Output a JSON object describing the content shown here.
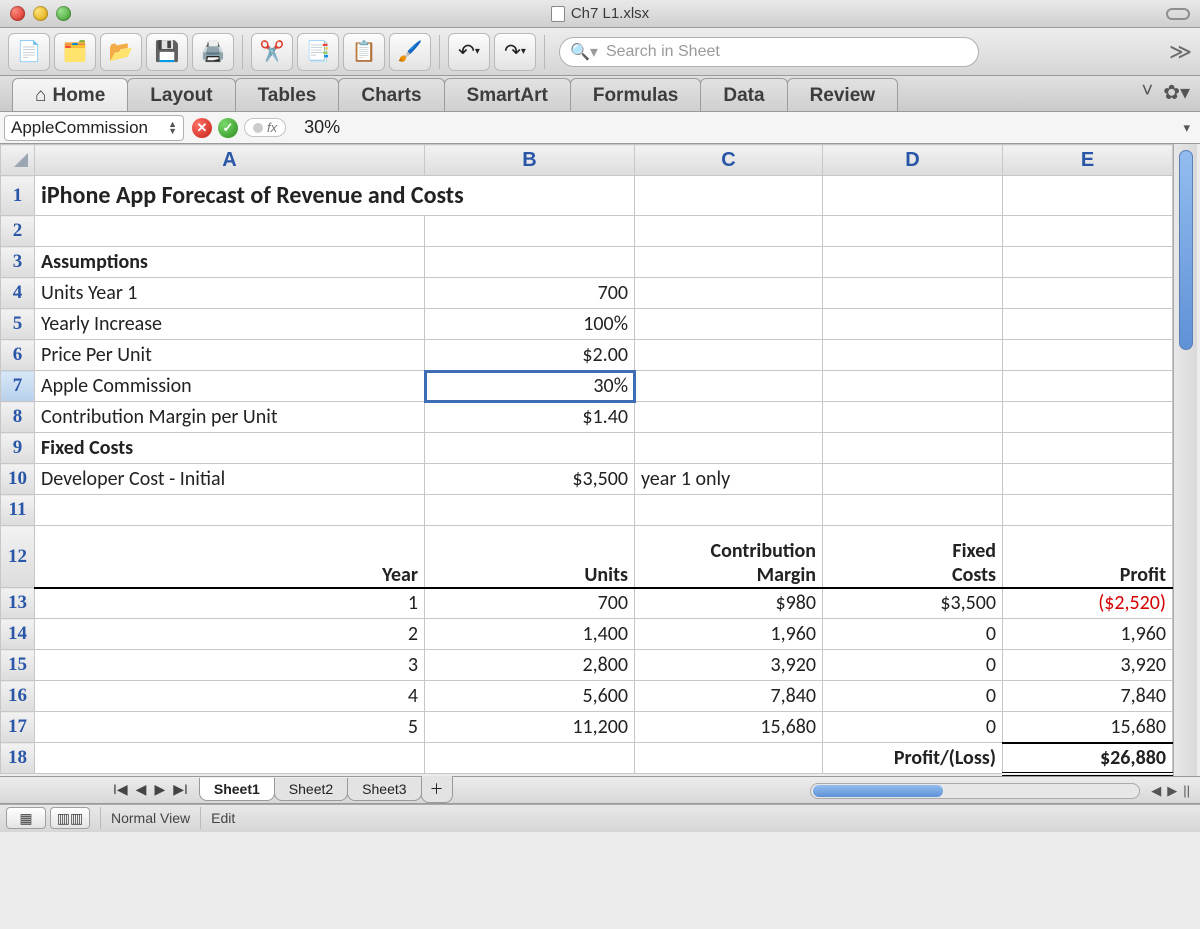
{
  "window": {
    "filename": "Ch7 L1.xlsx"
  },
  "toolbar": {
    "icons": [
      "new-sheet-icon",
      "chart-wizard-icon",
      "open-icon",
      "save-icon",
      "print-icon",
      "cut-icon",
      "copy-icon",
      "paste-icon",
      "format-painter-icon",
      "undo-icon",
      "redo-icon"
    ],
    "search_placeholder": "Search in Sheet"
  },
  "ribbon": {
    "tabs": [
      "Home",
      "Layout",
      "Tables",
      "Charts",
      "SmartArt",
      "Formulas",
      "Data",
      "Review"
    ],
    "active": "Home"
  },
  "formula_bar": {
    "name_box": "AppleCommission",
    "fx_label": "fx",
    "value": "30%"
  },
  "columns": [
    "A",
    "B",
    "C",
    "D",
    "E"
  ],
  "rows_visible": [
    1,
    2,
    3,
    4,
    5,
    6,
    7,
    8,
    9,
    10,
    11,
    12,
    13,
    14,
    15,
    16,
    17,
    18
  ],
  "active_cell": "B7",
  "sheet": {
    "title": "iPhone App Forecast of Revenue and Costs",
    "section_assumptions": "Assumptions",
    "assumptions": {
      "units_year1_label": "Units Year 1",
      "units_year1_value": "700",
      "yearly_increase_label": "Yearly Increase",
      "yearly_increase_value": "100%",
      "price_per_unit_label": "Price Per Unit",
      "price_per_unit_value": "$2.00",
      "apple_commission_label": "Apple Commission",
      "apple_commission_value": "30%",
      "contribution_margin_label": "Contribution Margin per Unit",
      "contribution_margin_value": "$1.40"
    },
    "section_fixed": "Fixed  Costs",
    "fixed": {
      "dev_cost_label": "Developer Cost - Initial",
      "dev_cost_value": "$3,500",
      "dev_cost_note": "year 1 only"
    },
    "table_headers": {
      "year": "Year",
      "units": "Units",
      "contribution_l1": "Contribution",
      "contribution_l2": "Margin",
      "fixed_l1": "Fixed",
      "fixed_l2": "Costs",
      "profit": "Profit"
    },
    "rows": [
      {
        "year": "1",
        "units": "700",
        "margin": "$980",
        "fixed": "$3,500",
        "profit": "($2,520)",
        "neg": true
      },
      {
        "year": "2",
        "units": "1,400",
        "margin": "1,960",
        "fixed": "0",
        "profit": "1,960"
      },
      {
        "year": "3",
        "units": "2,800",
        "margin": "3,920",
        "fixed": "0",
        "profit": "3,920"
      },
      {
        "year": "4",
        "units": "5,600",
        "margin": "7,840",
        "fixed": "0",
        "profit": "7,840"
      },
      {
        "year": "5",
        "units": "11,200",
        "margin": "15,680",
        "fixed": "0",
        "profit": "15,680"
      }
    ],
    "total_label": "Profit/(Loss)",
    "total_value": "$26,880"
  },
  "sheet_tabs": {
    "tabs": [
      "Sheet1",
      "Sheet2",
      "Sheet3"
    ],
    "active": "Sheet1"
  },
  "status": {
    "view_label": "Normal View",
    "mode": "Edit"
  }
}
